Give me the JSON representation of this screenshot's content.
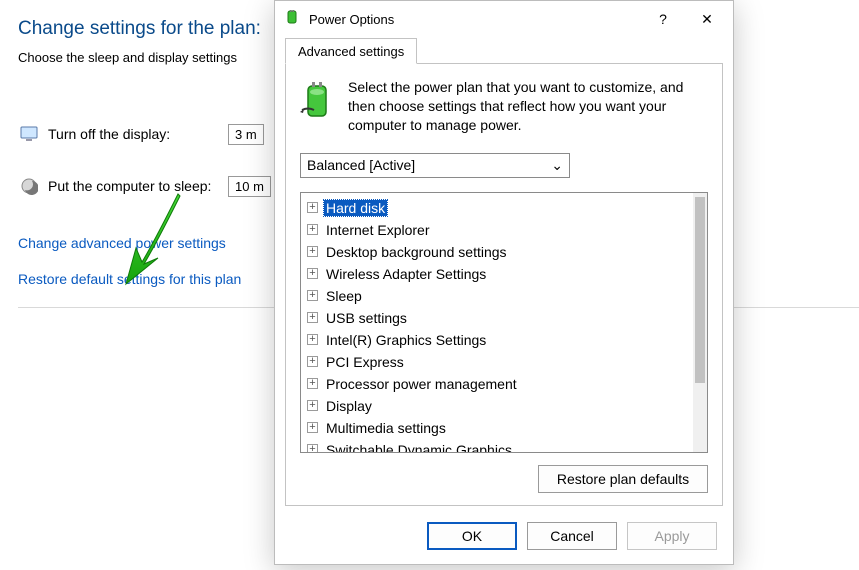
{
  "bg": {
    "title": "Change settings for the plan:",
    "subtitle": "Choose the sleep and display settings",
    "rows": {
      "display": {
        "label": "Turn off the display:",
        "value": "3 m"
      },
      "sleep": {
        "label": "Put the computer to sleep:",
        "value": "10 m"
      }
    },
    "links": {
      "advanced": "Change advanced power settings",
      "restore": "Restore default settings for this plan"
    }
  },
  "dialog": {
    "title": "Power Options",
    "tab": "Advanced settings",
    "intro": "Select the power plan that you want to customize, and then choose settings that reflect how you want your computer to manage power.",
    "plan": "Balanced [Active]",
    "tree": [
      {
        "label": "Hard disk",
        "selected": true
      },
      {
        "label": "Internet Explorer"
      },
      {
        "label": "Desktop background settings"
      },
      {
        "label": "Wireless Adapter Settings"
      },
      {
        "label": "Sleep"
      },
      {
        "label": "USB settings"
      },
      {
        "label": "Intel(R) Graphics Settings"
      },
      {
        "label": "PCI Express"
      },
      {
        "label": "Processor power management"
      },
      {
        "label": "Display"
      },
      {
        "label": "Multimedia settings"
      },
      {
        "label": "Switchable Dynamic Graphics"
      }
    ],
    "buttons": {
      "restore_defaults": "Restore plan defaults",
      "ok": "OK",
      "cancel": "Cancel",
      "apply": "Apply"
    }
  },
  "icons": {
    "monitor": "monitor-icon",
    "moon": "moon-icon",
    "battery": "battery-icon",
    "help": "?",
    "close": "✕",
    "chevron": "⌄",
    "plus": "+"
  }
}
